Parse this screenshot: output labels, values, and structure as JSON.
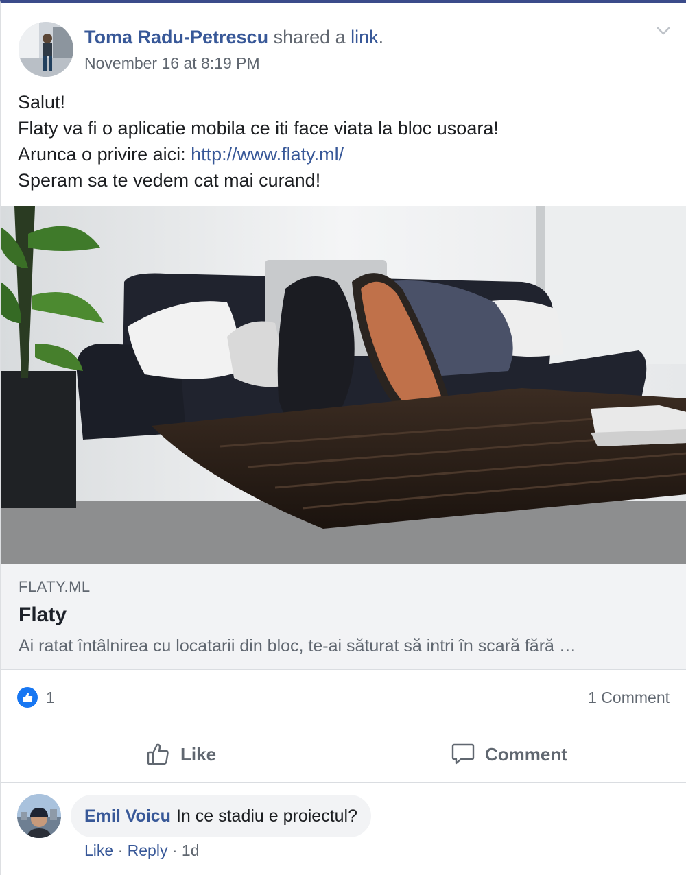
{
  "post": {
    "author": "Toma Radu-Petrescu",
    "action_text": " shared a ",
    "action_link": "link",
    "action_end": ".",
    "timestamp": "November 16 at 8:19 PM",
    "menu_icon": "chevron-down-icon",
    "message": {
      "line1": "Salut!",
      "line2": "Flaty va fi o aplicatie mobila ce iti face viata la bloc usoara!",
      "line3_prefix": "Arunca o privire aici: ",
      "line3_link": "http://www.flaty.ml/",
      "line4": "Speram sa te vedem cat mai curand!"
    }
  },
  "link_card": {
    "domain": "FLATY.ML",
    "title": "Flaty",
    "description": "Ai ratat întâlnirea cu locatarii din bloc, te-ai săturat să intri în scară fără …"
  },
  "reactions": {
    "icon": "thumbs-up-icon",
    "like_count": "1",
    "comments_label": "1 Comment"
  },
  "actions": {
    "like_label": "Like",
    "comment_label": "Comment"
  },
  "comment": {
    "author": "Emil Voicu",
    "text": "In ce stadiu e proiectul?",
    "like_label": "Like",
    "sep1": " · ",
    "reply_label": "Reply",
    "sep2": " · ",
    "age": "1d"
  },
  "colors": {
    "link_blue": "#385898",
    "like_badge": "#1877f2",
    "card_bg": "#f2f3f5"
  }
}
